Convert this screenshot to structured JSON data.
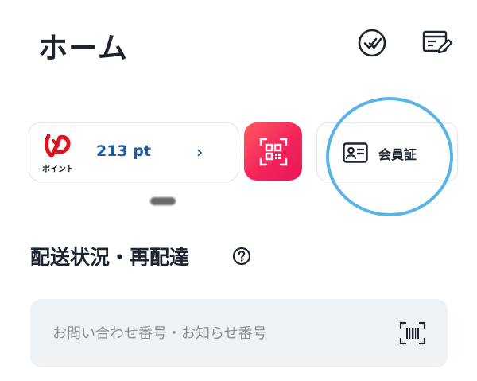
{
  "header": {
    "title": "ホーム",
    "icons": [
      "check-circle-icon",
      "news-edit-icon"
    ]
  },
  "points": {
    "logo_label": "ポイント",
    "value": "213 pt",
    "chevron": "›"
  },
  "qr": {
    "icon": "qr-scan-icon"
  },
  "member": {
    "label": "会員証",
    "icon": "member-card-icon"
  },
  "delivery": {
    "title": "配送状況・再配達",
    "search_placeholder": "お問い合わせ番号・お知らせ番号",
    "search_value": ""
  },
  "colors": {
    "text": "#1c2430",
    "accent_blue": "#1b5ea8",
    "qr_gradient_start": "#ff5a5f",
    "qr_gradient_end": "#e8175c",
    "highlight_ring": "#5ab4e5",
    "search_bg": "#eef2f4",
    "logo_red": "#d9141e"
  }
}
